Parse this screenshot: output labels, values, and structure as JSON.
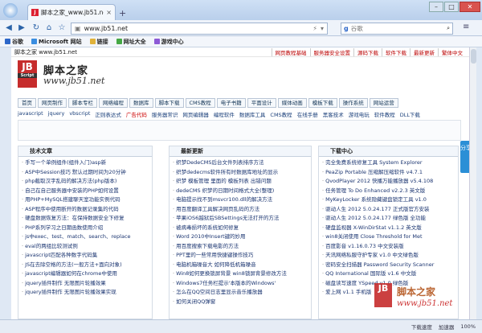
{
  "browser": {
    "tab_title": "脚本之家_www.jb51.net",
    "address": "www.jb51.net",
    "search_placeholder": "谷歌",
    "bookmarks": [
      "谷歌",
      "Microsoft 网站",
      "链接",
      "网址大全",
      "游戏中心"
    ]
  },
  "page": {
    "top_left": "脚本之家 www.jb51.net",
    "top_links": [
      "网页教程基础",
      "服务器安全设置",
      "源码下载",
      "软件下载",
      "最新更新",
      "繁体中文"
    ],
    "site_name": "脚本之家",
    "site_url": "www.jb51.net",
    "logo_letters": "JB",
    "logo_sub": "Script",
    "main_nav": [
      "首页",
      "网页制作",
      "脚本专栏",
      "网络编程",
      "数据库",
      "脚本下载",
      "CMS教程",
      "电子书籍",
      "平面设计",
      "媒体动画",
      "模板下载",
      "操作系统",
      "网站运营"
    ],
    "sub_nav": [
      "javascript",
      "jquery",
      "vbscript",
      "正则表达式",
      "广告代码",
      "服务器常识",
      "网页编辑器",
      "编程软件",
      "数据库工具",
      "CMS教程",
      "在线手册",
      "黑客技术",
      "游戏电玩",
      "软件教程",
      "DLL下载"
    ],
    "sub_nav_highlight": "广告代码",
    "share_label": "分享",
    "panels": [
      {
        "title": "技术文章",
        "items": [
          "手写一个单例组件(组件入门)asp新",
          "ASP中Session技巧 默认过期时间为20分钟",
          "php截取汉字乱码的解决方法(php版本)",
          "自己在自己服务器中安装的PHP如何设置",
          "用PHP+MySQL搭建聊天室功能实例代码",
          "ASP程序中使用断开的数据记录集的代码",
          "硬盘数据恢复方法：在保持数据安全下修复",
          "PHP系列学习之日期函数使用介绍",
          "js中exec、test、match、search、replace",
          "eval的两组比较测试例",
          "javascript匹配各种数字代码集",
          "JS在去除空格的方法(一般方法+面向对象)",
          "javascript编辑器如何在chrome中使用",
          "jquery插件制作 无限图片轮播效果",
          "jquery插件制作 无限图片轮播效果实现"
        ]
      },
      {
        "title": "最新更新",
        "items": [
          "织梦DedeCMS后台文件列表排序方法",
          "织梦dedecms软件所有时数据库地址的显示",
          "织梦 模板管理 里面的 模板列表 出错问题",
          "dedeCMS 织梦的日期时间格式大全(整理)",
          "电脑提示找不到msvcr100.dll的解决方法",
          "用百度翻译工具解决网页乱码的方法",
          "苹果iOS6越狱后SBSettings无法打开的方法",
          "被病毒损坏的系统如何修复",
          "Word 2010中Insert键的妙用",
          "用百度搜索下载电影的方法",
          "PPT里的一些常用快捷键操作技巧",
          "电脑机箱噪音大 如何降低机箱噪音",
          "Win8如何更换锁屏背景 win8锁屏背景修改方法",
          "Windows7任务栏提示'本版本的Windows'",
          "怎么在QQ空间日志里显示音乐播放器",
          "如何关闭QQ弹窗"
        ]
      },
      {
        "title": "下载中心",
        "items": [
          "完全免费系统修复工具 System Explorer",
          "PeaZip Portable 压缩解压缩软件 v4.7.1",
          "QvodPlayer 2012 快播万能播放器 v5.4.108",
          "任务管理 To Do Enhanced v2.2.3 英文版",
          "MyKeyLocker 系统隐藏键盘锁定工具 v1.0",
          "驱动人生 2012 5.0.24.177 正式版官方安装",
          "驱动人生 2012 5.0.24.177 绿色版 全功能",
          "硬盘监视器 X-WinDirStat v1.1.2 英文版",
          "win8关闭使用 Close Threshold for Met",
          "百度影音 v1.16.0.73 中文安装版",
          "天讯网络私服守护专家 v1.0 中文绿色版",
          "密码安全扫描器 Password Security Scanner",
          "QQ International 国际版 v1.6 中文版",
          "磁盘读写速度 YSpeed v1.0 绿色版",
          "爱上网 v1.1 手机版"
        ]
      }
    ]
  },
  "watermark": {
    "name": "脚本之家",
    "url": "www.jb51.net",
    "letters": "JB"
  },
  "status": {
    "items": [
      "下载速度",
      "加速器",
      "100%"
    ]
  }
}
